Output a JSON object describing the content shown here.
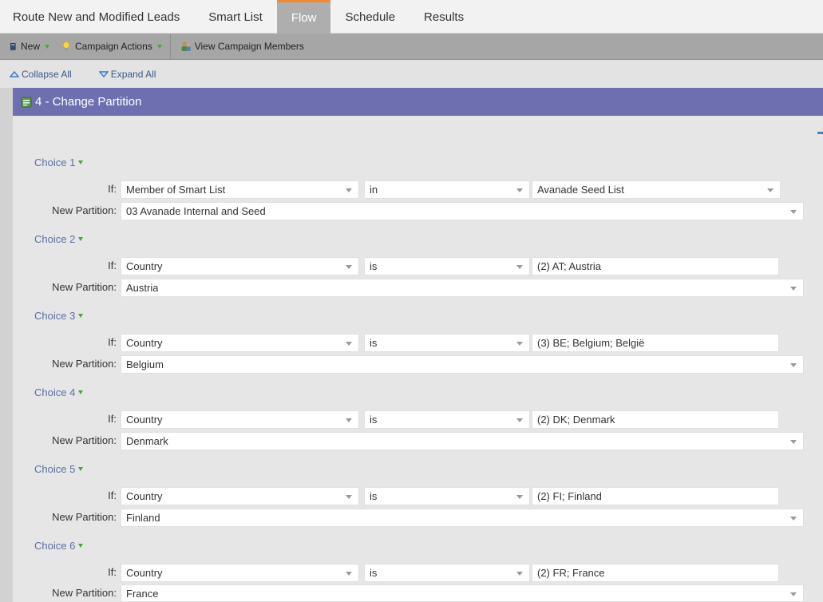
{
  "tabs": [
    {
      "label": "Route New and Modified Leads",
      "active": false
    },
    {
      "label": "Smart List",
      "active": false
    },
    {
      "label": "Flow",
      "active": true
    },
    {
      "label": "Schedule",
      "active": false
    },
    {
      "label": "Results",
      "active": false
    }
  ],
  "toolbar": {
    "new_label": "New",
    "campaign_actions_label": "Campaign Actions",
    "view_members_label": "View Campaign Members"
  },
  "collapse": {
    "collapse_all_label": "Collapse All",
    "expand_all_label": "Expand All"
  },
  "step": {
    "title": "4 - Change Partition"
  },
  "labels": {
    "if": "If:",
    "new_partition": "New Partition:"
  },
  "choices": [
    {
      "label": "Choice 1",
      "attribute": "Member of Smart List",
      "operator": "in",
      "value": "Avanade Seed List",
      "value_dropdown": true,
      "partition": "03 Avanade Internal and Seed"
    },
    {
      "label": "Choice 2",
      "attribute": "Country",
      "operator": "is",
      "value": "(2) AT; Austria",
      "value_dropdown": false,
      "partition": "Austria"
    },
    {
      "label": "Choice 3",
      "attribute": "Country",
      "operator": "is",
      "value": "(3) BE; Belgium; België",
      "value_dropdown": false,
      "partition": "Belgium"
    },
    {
      "label": "Choice 4",
      "attribute": "Country",
      "operator": "is",
      "value": "(2) DK; Denmark",
      "value_dropdown": false,
      "partition": "Denmark"
    },
    {
      "label": "Choice 5",
      "attribute": "Country",
      "operator": "is",
      "value": "(2) FI; Finland",
      "value_dropdown": false,
      "partition": "Finland"
    },
    {
      "label": "Choice 6",
      "attribute": "Country",
      "operator": "is",
      "value": "(2) FR; France",
      "value_dropdown": false,
      "partition": "France"
    }
  ],
  "colors": {
    "active_tab_accent": "#f08a38",
    "step_header": "#6e6fb1",
    "choice_link": "#5a6fa6"
  }
}
